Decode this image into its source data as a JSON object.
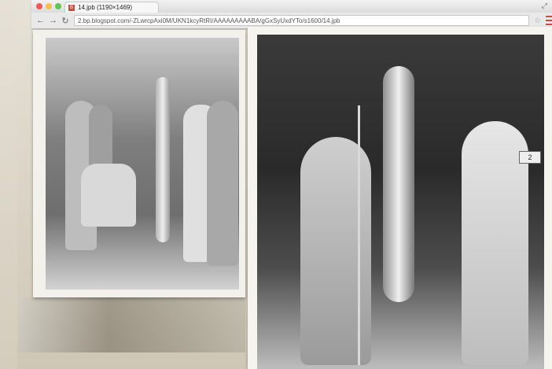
{
  "browser": {
    "tab_title": "14.jpb (1190×1469)",
    "url": "2.bp.blogspot.com/-ZLwrcpAxi0M/UKN1kcyRtRI/AAAAAAAAABA/gGxSyUxdYTo/s1600/14.jpb",
    "favicon_text": "B",
    "icons": {
      "back": "back-arrow-icon",
      "forward": "forward-arrow-icon",
      "reload": "reload-icon",
      "bookmark": "star-icon",
      "menu": "menu-icon",
      "expand": "expand-icon"
    }
  },
  "photos": {
    "right": {
      "sign": "2"
    }
  },
  "colors": {
    "favicon": "#d04b3c",
    "menu": "#d04b3c"
  }
}
